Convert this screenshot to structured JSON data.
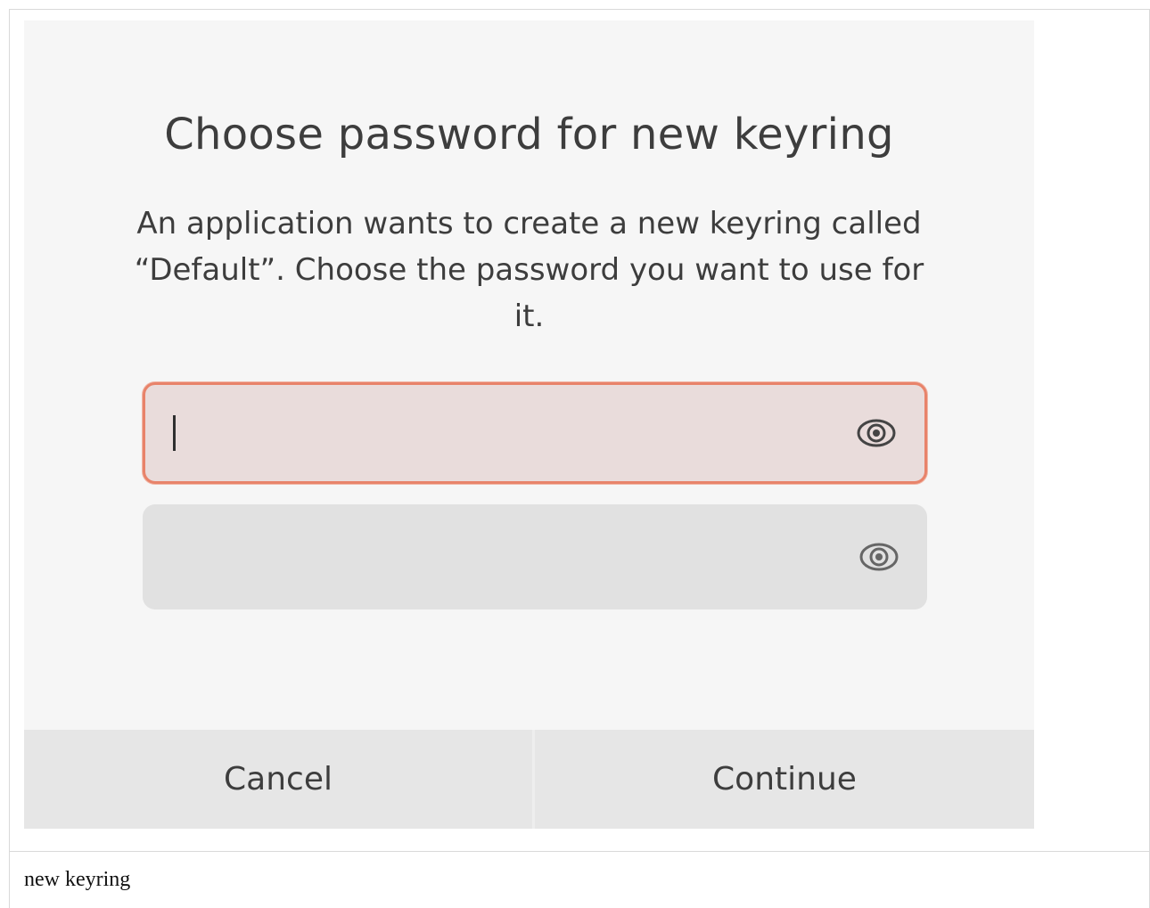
{
  "dialog": {
    "title": "Choose password for new keyring",
    "message": "An application wants to create a new keyring called “Default”. Choose the password you want to use for it.",
    "fields": [
      {
        "value": "",
        "icon": "eye-icon",
        "focused": true
      },
      {
        "value": "",
        "icon": "eye-icon",
        "focused": false
      }
    ],
    "buttons": {
      "cancel_label": "Cancel",
      "continue_label": "Continue"
    }
  },
  "caption": "new keyring",
  "colors": {
    "focus_border": "#e8836a",
    "dialog_bg": "#f6f6f6",
    "button_bg": "#e6e6e6"
  }
}
